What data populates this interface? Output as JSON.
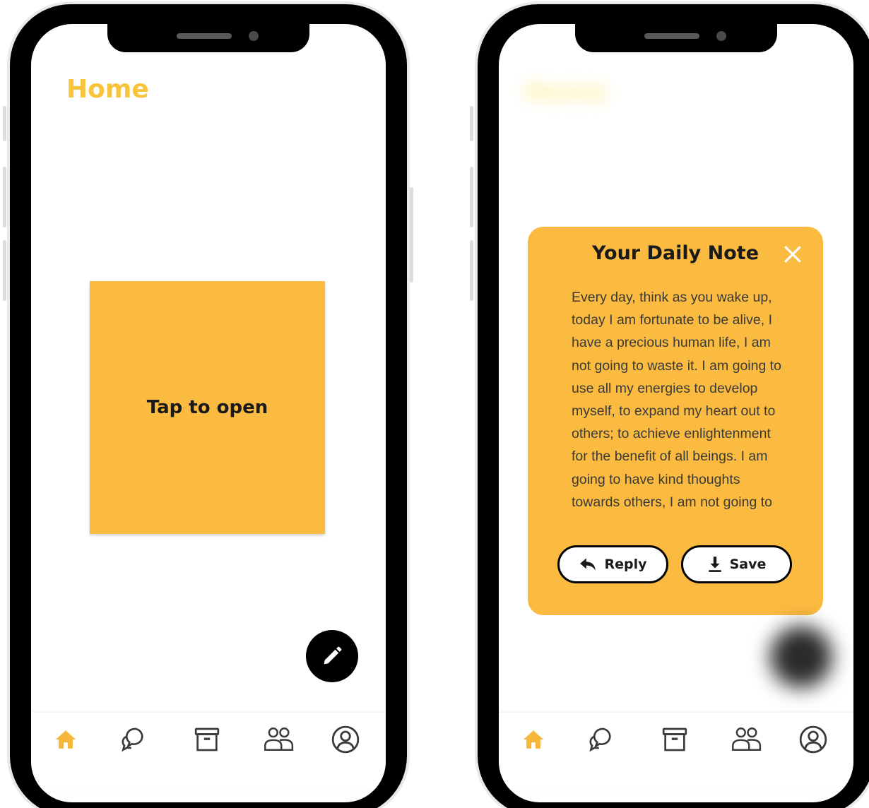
{
  "colors": {
    "accent": "#fbbb40",
    "title_yellow": "#f7c43c",
    "nav_active": "#f6b73a",
    "nav_inactive": "#3a3a3a"
  },
  "home_screen": {
    "title": "Home",
    "note_card": {
      "label": "Tap to open"
    },
    "fab": {
      "icon": "pencil-icon"
    }
  },
  "note_screen": {
    "popup": {
      "title": "Your Daily Note",
      "close_icon": "close-icon",
      "body_lines": [
        "Every day, think as you wake up,",
        "today I am fortunate to be alive, I",
        "have a precious human life, I am",
        "not going to waste it. I am going to",
        "use all my energies to develop",
        "myself, to expand my heart out to",
        "others; to achieve enlightenment",
        "for the benefit of all beings. I am",
        "going to have kind thoughts",
        "towards others, I am not going to"
      ],
      "reply_label": "Reply",
      "save_label": "Save"
    }
  },
  "bottom_nav": [
    {
      "icon": "home-icon",
      "active": true
    },
    {
      "icon": "chat-bubbles-icon",
      "active": false
    },
    {
      "icon": "archive-box-icon",
      "active": false
    },
    {
      "icon": "friends-icon",
      "active": false
    },
    {
      "icon": "profile-icon",
      "active": false
    }
  ]
}
